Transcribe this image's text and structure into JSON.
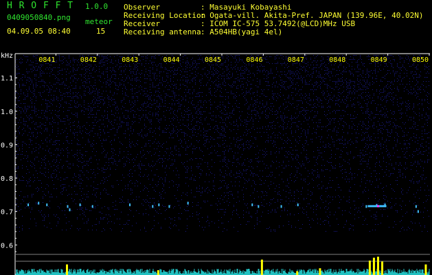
{
  "app": {
    "name": "H R O F F T",
    "version": "1.0.0",
    "filename": "0409050840.png",
    "meteor_label": "meteor",
    "meteor_count": "15",
    "datetime": "04.09.05 08:40"
  },
  "info": {
    "rows": [
      {
        "label": "Observer",
        "value": ": Masayuki Kobayashi"
      },
      {
        "label": "Receiving Location",
        "value": ": Ogata-vill. Akita-Pref. JAPAN (139.96E, 40.02N)"
      },
      {
        "label": "Receiver",
        "value": ": ICOM IC-575 53.7492(@LCD)MHz USB"
      },
      {
        "label": "Receiving antenna",
        "value": ": A504HB(yagi 4el)"
      }
    ]
  },
  "spectrogram": {
    "unit_label": "kHz",
    "time_labels": [
      "0841",
      "0842",
      "0843",
      "0844",
      "0845",
      "0846",
      "0847",
      "0848",
      "0849",
      "0850"
    ],
    "freq_labels": [
      "1.1",
      "1.0",
      "0.9",
      "0.8",
      "0.7",
      "0.6"
    ],
    "freq_values": [
      1.1,
      1.0,
      0.9,
      0.8,
      0.7,
      0.6
    ],
    "freq_range": [
      0.58,
      1.16
    ],
    "time_range": [
      0,
      10
    ],
    "colors": {
      "background": "#000000",
      "noise": "#1a1a8c",
      "echo": "#40c0ff",
      "echo_hot": "#ff40ff",
      "time_label": "#ffff00",
      "axis_label": "#ffffff",
      "level": "#ffff00",
      "level_low": "#20c0c0",
      "separator": "#808080"
    },
    "echoes": [
      {
        "t": 0.3,
        "f": 0.72
      },
      {
        "t": 0.55,
        "f": 0.725
      },
      {
        "t": 0.75,
        "f": 0.72
      },
      {
        "t": 1.25,
        "f": 0.715
      },
      {
        "t": 1.3,
        "f": 0.705
      },
      {
        "t": 1.55,
        "f": 0.72
      },
      {
        "t": 1.85,
        "f": 0.715
      },
      {
        "t": 2.75,
        "f": 0.72
      },
      {
        "t": 3.3,
        "f": 0.715
      },
      {
        "t": 3.45,
        "f": 0.72
      },
      {
        "t": 3.7,
        "f": 0.715
      },
      {
        "t": 4.15,
        "f": 0.725
      },
      {
        "t": 5.7,
        "f": 0.72
      },
      {
        "t": 5.85,
        "f": 0.715
      },
      {
        "t": 6.4,
        "f": 0.715
      },
      {
        "t": 6.8,
        "f": 0.72
      },
      {
        "t": 8.45,
        "f": 0.715
      },
      {
        "t": 8.7,
        "f": 0.718
      },
      {
        "t": 8.9,
        "f": 0.72
      },
      {
        "t": 9.65,
        "f": 0.715
      },
      {
        "t": 9.7,
        "f": 0.7
      }
    ],
    "long_echoes": [
      {
        "t_start": 8.5,
        "t_end": 8.95,
        "f": 0.717
      }
    ],
    "level_peaks": [
      {
        "t": 1.25,
        "v": 0.55
      },
      {
        "t": 5.95,
        "v": 0.8
      },
      {
        "t": 7.35,
        "v": 0.35
      },
      {
        "t": 8.55,
        "v": 0.75
      },
      {
        "t": 8.65,
        "v": 0.9
      },
      {
        "t": 8.75,
        "v": 0.95
      },
      {
        "t": 8.85,
        "v": 0.7
      },
      {
        "t": 9.9,
        "v": 0.55
      },
      {
        "t": 3.45,
        "v": 0.25
      },
      {
        "t": 6.8,
        "v": 0.2
      }
    ]
  }
}
